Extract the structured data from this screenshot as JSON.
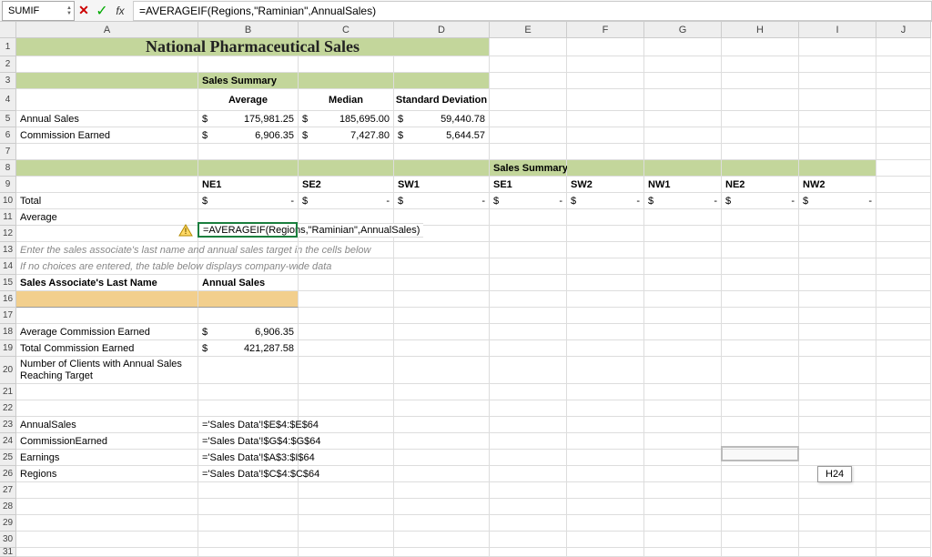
{
  "nameBox": "SUMIF",
  "formula": "=AVERAGEIF(Regions,\"Raminian\",AnnualSales)",
  "formulaInCell": "=AVERAGEIF(Regions,\"Raminian\",AnnualSales)",
  "cols": [
    "A",
    "B",
    "C",
    "D",
    "E",
    "F",
    "G",
    "H",
    "I",
    "J"
  ],
  "rows": [
    "1",
    "2",
    "3",
    "4",
    "5",
    "6",
    "7",
    "8",
    "9",
    "10",
    "11",
    "12",
    "13",
    "14",
    "15",
    "16",
    "17",
    "18",
    "19",
    "20",
    "21",
    "22",
    "23",
    "24",
    "25",
    "26",
    "27",
    "28",
    "29",
    "30",
    "31"
  ],
  "title": "National Pharmaceutical Sales",
  "section1": "Sales Summary",
  "stats": {
    "avg": "Average",
    "med": "Median",
    "std": "Standard Deviation"
  },
  "row5": {
    "label": "Annual Sales",
    "b": "175,981.25",
    "c": "185,695.00",
    "d": "59,440.78",
    "cur": "$"
  },
  "row6": {
    "label": "Commission Earned",
    "b": "6,906.35",
    "c": "7,427.80",
    "d": "5,644.57",
    "cur": "$"
  },
  "section2": "Sales Summary by Region",
  "regions": {
    "b": "NE1",
    "c": "SE2",
    "d": "SW1",
    "e": "SE1",
    "f": "SW2",
    "g": "NW1",
    "h": "NE2",
    "i": "NW2"
  },
  "row10": {
    "label": "Total",
    "dash": "-",
    "cur": "$"
  },
  "row11": {
    "label": "Average"
  },
  "row13": "Enter the sales associate's last name and annual sales target in the cells below",
  "row14": "If no choices are entered, the table below displays company-wide data",
  "row15": {
    "a": "Sales Associate's Last Name",
    "b": "Annual Sales"
  },
  "row18": {
    "label": "Average Commission Earned",
    "val": "6,906.35",
    "cur": "$"
  },
  "row19": {
    "label": "Total Commission Earned",
    "val": "421,287.58",
    "cur": "$"
  },
  "row20": "Number of Clients with Annual Sales Reaching Target",
  "row23": {
    "label": "AnnualSales",
    "val": "='Sales Data'!$E$4:$E$64"
  },
  "row24": {
    "label": "CommissionEarned",
    "val": "='Sales Data'!$G$4:$G$64"
  },
  "row25": {
    "label": "Earnings",
    "val": "='Sales Data'!$A$3:$I$64"
  },
  "row26": {
    "label": "Regions",
    "val": "='Sales Data'!$C$4:$C$64"
  },
  "hoverCell": "H24"
}
